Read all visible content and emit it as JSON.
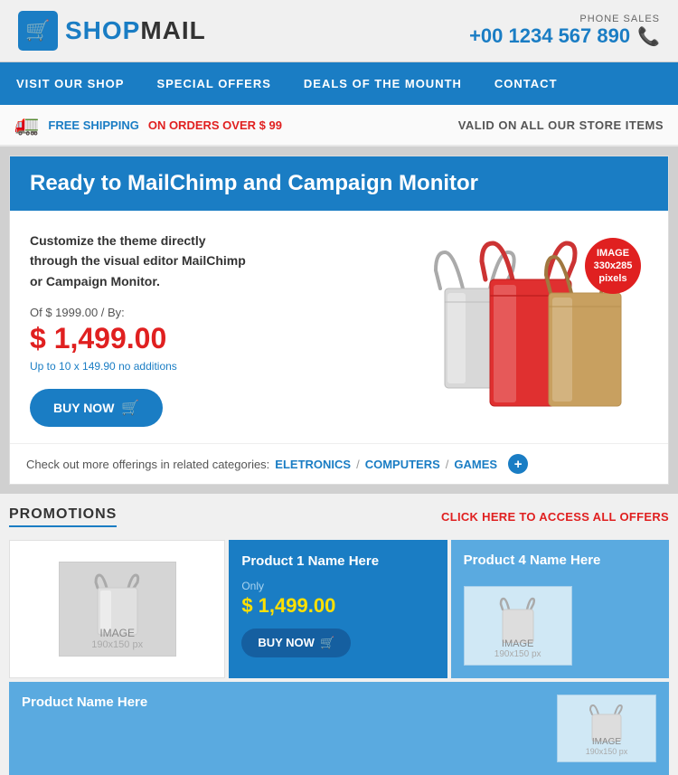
{
  "header": {
    "logo_text_shop": "SHOP",
    "logo_text_mail": "MAIL",
    "phone_label": "PHONE SALES",
    "phone_number": "+00 1234 567 890"
  },
  "nav": {
    "items": [
      {
        "label": "VISIT OUR SHOP",
        "id": "visit-shop"
      },
      {
        "label": "SPECIAL OFFERS",
        "id": "special-offers"
      },
      {
        "label": "DEALS OF THE MOUNTH",
        "id": "deals"
      },
      {
        "label": "CONTACT",
        "id": "contact"
      }
    ]
  },
  "shipping_bar": {
    "free_text": "FREE SHIPPING",
    "order_text": "ON ORDERS OVER $ 99",
    "valid_text": "VALID ON ALL OUR STORE ITEMS"
  },
  "hero": {
    "title": "Ready to MailChimp and Campaign Monitor",
    "description": "Customize the theme directly\nthrough the visual editor MailChimp\nor Campaign Monitor.",
    "original_price": "Of $ 1999.00 / By:",
    "sale_price": "$ 1,499.00",
    "installments": "Up to 10 x 149.90 no additions",
    "buy_now_label": "BUY NOW",
    "image_badge": "IMAGE\n330x285\npixels",
    "image_badge_line1": "IMAGE",
    "image_badge_line2": "330x285",
    "image_badge_line3": "pixels"
  },
  "related": {
    "label": "Check out more offerings in related categories:",
    "links": [
      "ELETRONICS",
      "COMPUTERS",
      "GAMES"
    ]
  },
  "promotions": {
    "title": "PROMOTIONS",
    "access_label": "CLICK HERE TO ACCESS ALL OFFERS",
    "product1": {
      "image_label": "IMAGE",
      "image_size": "190x150 px"
    },
    "product2": {
      "name": "Product 1 Name Here",
      "only_label": "Only",
      "price": "$ 1,499.00",
      "buy_label": "BUY NOW"
    },
    "product3": {
      "name": "Product 4 Name Here",
      "image_label": "IMAGE",
      "image_size": "190x150 px"
    },
    "product4": {
      "name": "Product Name Here",
      "image_label": "IMAGE",
      "image_size": "190x150 px"
    }
  }
}
